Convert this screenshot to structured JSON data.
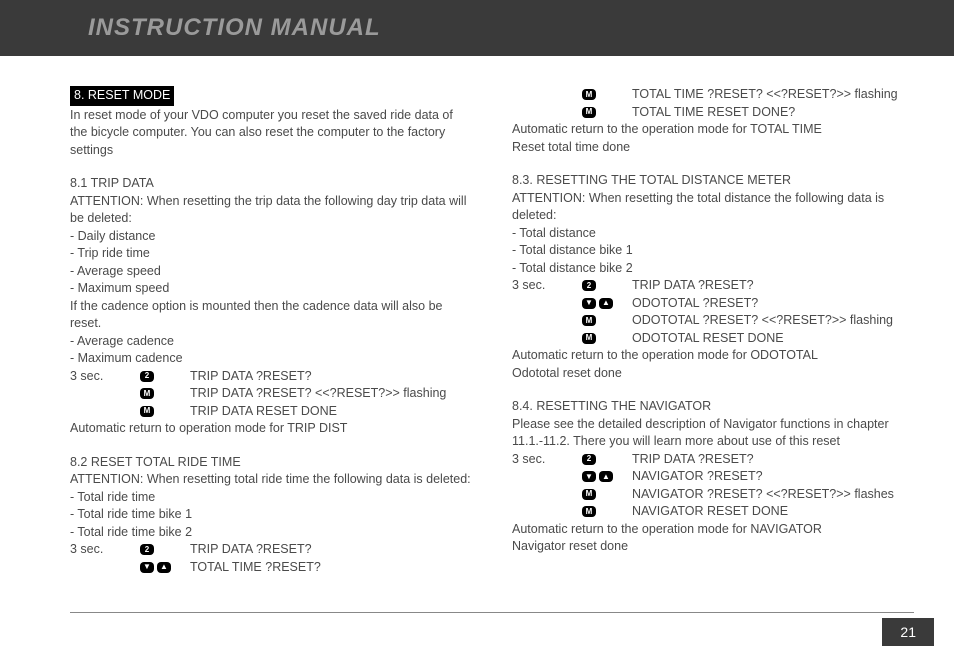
{
  "header": {
    "title": "INSTRUCTION MANUAL"
  },
  "page_number": "21",
  "left": {
    "section_heading": " 8. RESET MODE ",
    "intro": "In reset mode of your VDO computer you reset the saved ride data of the bicycle computer. You can also reset the computer to the factory settings",
    "s81_title": "8.1 TRIP DATA",
    "s81_attn": "ATTENTION: When resetting the trip data the following day trip data will be deleted:",
    "s81_b1": "- Daily distance",
    "s81_b2": "- Trip ride time",
    "s81_b3": "- Average speed",
    "s81_b4": "- Maximum speed",
    "s81_note": "If the cadence option is mounted then the cadence data will also be reset.",
    "s81_b5": "- Average cadence",
    "s81_b6": "- Maximum cadence",
    "s81_step_prefix": "3 sec.",
    "s81_step1_text": "TRIP DATA ?RESET?",
    "s81_step2_text": "TRIP DATA ?RESET? <<?RESET?>> flashing",
    "s81_step3_text": "TRIP DATA RESET DONE",
    "s81_auto": "Automatic return to operation mode for TRIP DIST",
    "s82_title": "8.2 RESET TOTAL RIDE TIME",
    "s82_attn": "ATTENTION: When resetting total ride time the following data is deleted:",
    "s82_b1": "- Total ride time",
    "s82_b2": "- Total ride time bike 1",
    "s82_b3": "- Total ride time bike 2",
    "s82_step_prefix": "3 sec.",
    "s82_step1_text": "TRIP DATA ?RESET?",
    "s82_step2_text": "TOTAL TIME ?RESET?"
  },
  "right": {
    "cont_step1_text": "TOTAL TIME ?RESET? <<?RESET?>> flashing",
    "cont_step2_text": "TOTAL TIME RESET DONE?",
    "cont_auto": "Automatic return to the operation mode for TOTAL TIME",
    "cont_done": "Reset total time done",
    "s83_title": "8.3. RESETTING THE TOTAL DISTANCE METER",
    "s83_attn": "ATTENTION: When resetting the total distance the following data is deleted:",
    "s83_b1": "- Total distance",
    "s83_b2": "- Total distance bike 1",
    "s83_b3": "- Total distance bike 2",
    "s83_step_prefix": "3 sec.",
    "s83_step1_text": "TRIP DATA ?RESET?",
    "s83_step2_text": "ODOTOTAL ?RESET?",
    "s83_step3_text": "ODOTOTAL ?RESET? <<?RESET?>> flashing",
    "s83_step4_text": "ODOTOTAL RESET DONE",
    "s83_auto": "Automatic return to the operation mode for ODOTOTAL",
    "s83_done": "Odototal reset  done",
    "s84_title": "8.4. RESETTING THE NAVIGATOR",
    "s84_note": "Please see the detailed description of Navigator functions in chapter 11.1.-11.2. There you will learn more about use of this reset",
    "s84_step_prefix": "3 sec.",
    "s84_step1_text": "TRIP DATA ?RESET?",
    "s84_step2_text": "NAVIGATOR ?RESET?",
    "s84_step3_text": "NAVIGATOR ?RESET? <<?RESET?>> flashes",
    "s84_step4_text": "NAVIGATOR RESET DONE",
    "s84_auto": "Automatic return to the operation mode for NAVIGATOR",
    "s84_done": "Navigator reset done"
  },
  "icons": {
    "two": "2",
    "m": "M",
    "down": "▼",
    "up": "▲"
  }
}
